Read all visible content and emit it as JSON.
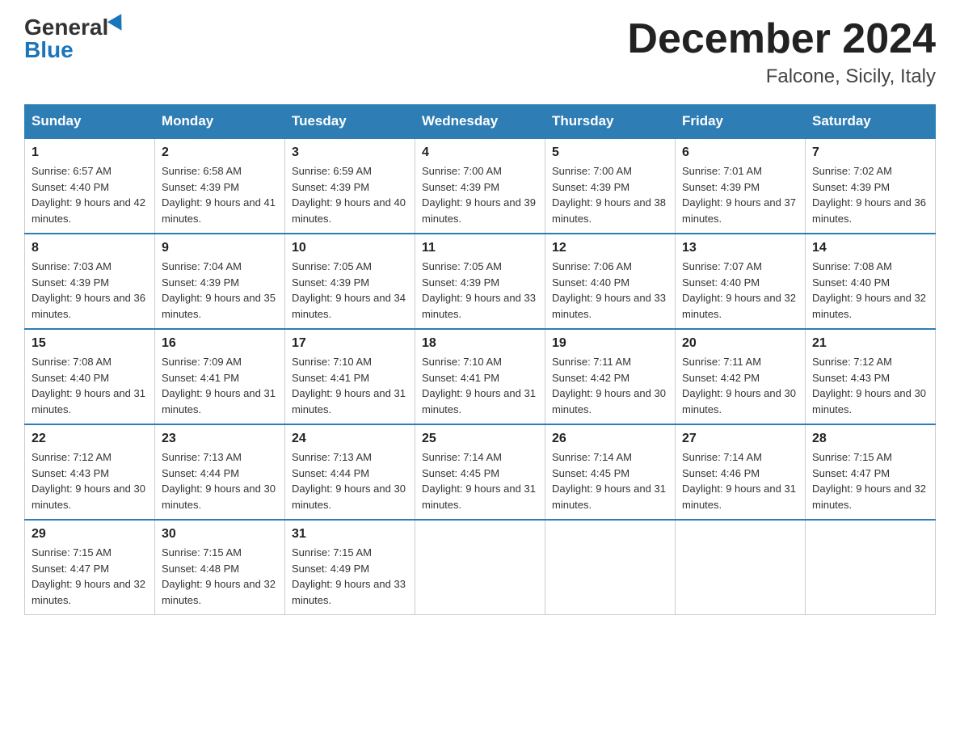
{
  "logo": {
    "general": "General",
    "blue": "Blue"
  },
  "title": "December 2024",
  "subtitle": "Falcone, Sicily, Italy",
  "days_of_week": [
    "Sunday",
    "Monday",
    "Tuesday",
    "Wednesday",
    "Thursday",
    "Friday",
    "Saturday"
  ],
  "weeks": [
    [
      {
        "day": "1",
        "sunrise": "6:57 AM",
        "sunset": "4:40 PM",
        "daylight": "9 hours and 42 minutes."
      },
      {
        "day": "2",
        "sunrise": "6:58 AM",
        "sunset": "4:39 PM",
        "daylight": "9 hours and 41 minutes."
      },
      {
        "day": "3",
        "sunrise": "6:59 AM",
        "sunset": "4:39 PM",
        "daylight": "9 hours and 40 minutes."
      },
      {
        "day": "4",
        "sunrise": "7:00 AM",
        "sunset": "4:39 PM",
        "daylight": "9 hours and 39 minutes."
      },
      {
        "day": "5",
        "sunrise": "7:00 AM",
        "sunset": "4:39 PM",
        "daylight": "9 hours and 38 minutes."
      },
      {
        "day": "6",
        "sunrise": "7:01 AM",
        "sunset": "4:39 PM",
        "daylight": "9 hours and 37 minutes."
      },
      {
        "day": "7",
        "sunrise": "7:02 AM",
        "sunset": "4:39 PM",
        "daylight": "9 hours and 36 minutes."
      }
    ],
    [
      {
        "day": "8",
        "sunrise": "7:03 AM",
        "sunset": "4:39 PM",
        "daylight": "9 hours and 36 minutes."
      },
      {
        "day": "9",
        "sunrise": "7:04 AM",
        "sunset": "4:39 PM",
        "daylight": "9 hours and 35 minutes."
      },
      {
        "day": "10",
        "sunrise": "7:05 AM",
        "sunset": "4:39 PM",
        "daylight": "9 hours and 34 minutes."
      },
      {
        "day": "11",
        "sunrise": "7:05 AM",
        "sunset": "4:39 PM",
        "daylight": "9 hours and 33 minutes."
      },
      {
        "day": "12",
        "sunrise": "7:06 AM",
        "sunset": "4:40 PM",
        "daylight": "9 hours and 33 minutes."
      },
      {
        "day": "13",
        "sunrise": "7:07 AM",
        "sunset": "4:40 PM",
        "daylight": "9 hours and 32 minutes."
      },
      {
        "day": "14",
        "sunrise": "7:08 AM",
        "sunset": "4:40 PM",
        "daylight": "9 hours and 32 minutes."
      }
    ],
    [
      {
        "day": "15",
        "sunrise": "7:08 AM",
        "sunset": "4:40 PM",
        "daylight": "9 hours and 31 minutes."
      },
      {
        "day": "16",
        "sunrise": "7:09 AM",
        "sunset": "4:41 PM",
        "daylight": "9 hours and 31 minutes."
      },
      {
        "day": "17",
        "sunrise": "7:10 AM",
        "sunset": "4:41 PM",
        "daylight": "9 hours and 31 minutes."
      },
      {
        "day": "18",
        "sunrise": "7:10 AM",
        "sunset": "4:41 PM",
        "daylight": "9 hours and 31 minutes."
      },
      {
        "day": "19",
        "sunrise": "7:11 AM",
        "sunset": "4:42 PM",
        "daylight": "9 hours and 30 minutes."
      },
      {
        "day": "20",
        "sunrise": "7:11 AM",
        "sunset": "4:42 PM",
        "daylight": "9 hours and 30 minutes."
      },
      {
        "day": "21",
        "sunrise": "7:12 AM",
        "sunset": "4:43 PM",
        "daylight": "9 hours and 30 minutes."
      }
    ],
    [
      {
        "day": "22",
        "sunrise": "7:12 AM",
        "sunset": "4:43 PM",
        "daylight": "9 hours and 30 minutes."
      },
      {
        "day": "23",
        "sunrise": "7:13 AM",
        "sunset": "4:44 PM",
        "daylight": "9 hours and 30 minutes."
      },
      {
        "day": "24",
        "sunrise": "7:13 AM",
        "sunset": "4:44 PM",
        "daylight": "9 hours and 30 minutes."
      },
      {
        "day": "25",
        "sunrise": "7:14 AM",
        "sunset": "4:45 PM",
        "daylight": "9 hours and 31 minutes."
      },
      {
        "day": "26",
        "sunrise": "7:14 AM",
        "sunset": "4:45 PM",
        "daylight": "9 hours and 31 minutes."
      },
      {
        "day": "27",
        "sunrise": "7:14 AM",
        "sunset": "4:46 PM",
        "daylight": "9 hours and 31 minutes."
      },
      {
        "day": "28",
        "sunrise": "7:15 AM",
        "sunset": "4:47 PM",
        "daylight": "9 hours and 32 minutes."
      }
    ],
    [
      {
        "day": "29",
        "sunrise": "7:15 AM",
        "sunset": "4:47 PM",
        "daylight": "9 hours and 32 minutes."
      },
      {
        "day": "30",
        "sunrise": "7:15 AM",
        "sunset": "4:48 PM",
        "daylight": "9 hours and 32 minutes."
      },
      {
        "day": "31",
        "sunrise": "7:15 AM",
        "sunset": "4:49 PM",
        "daylight": "9 hours and 33 minutes."
      },
      null,
      null,
      null,
      null
    ]
  ]
}
